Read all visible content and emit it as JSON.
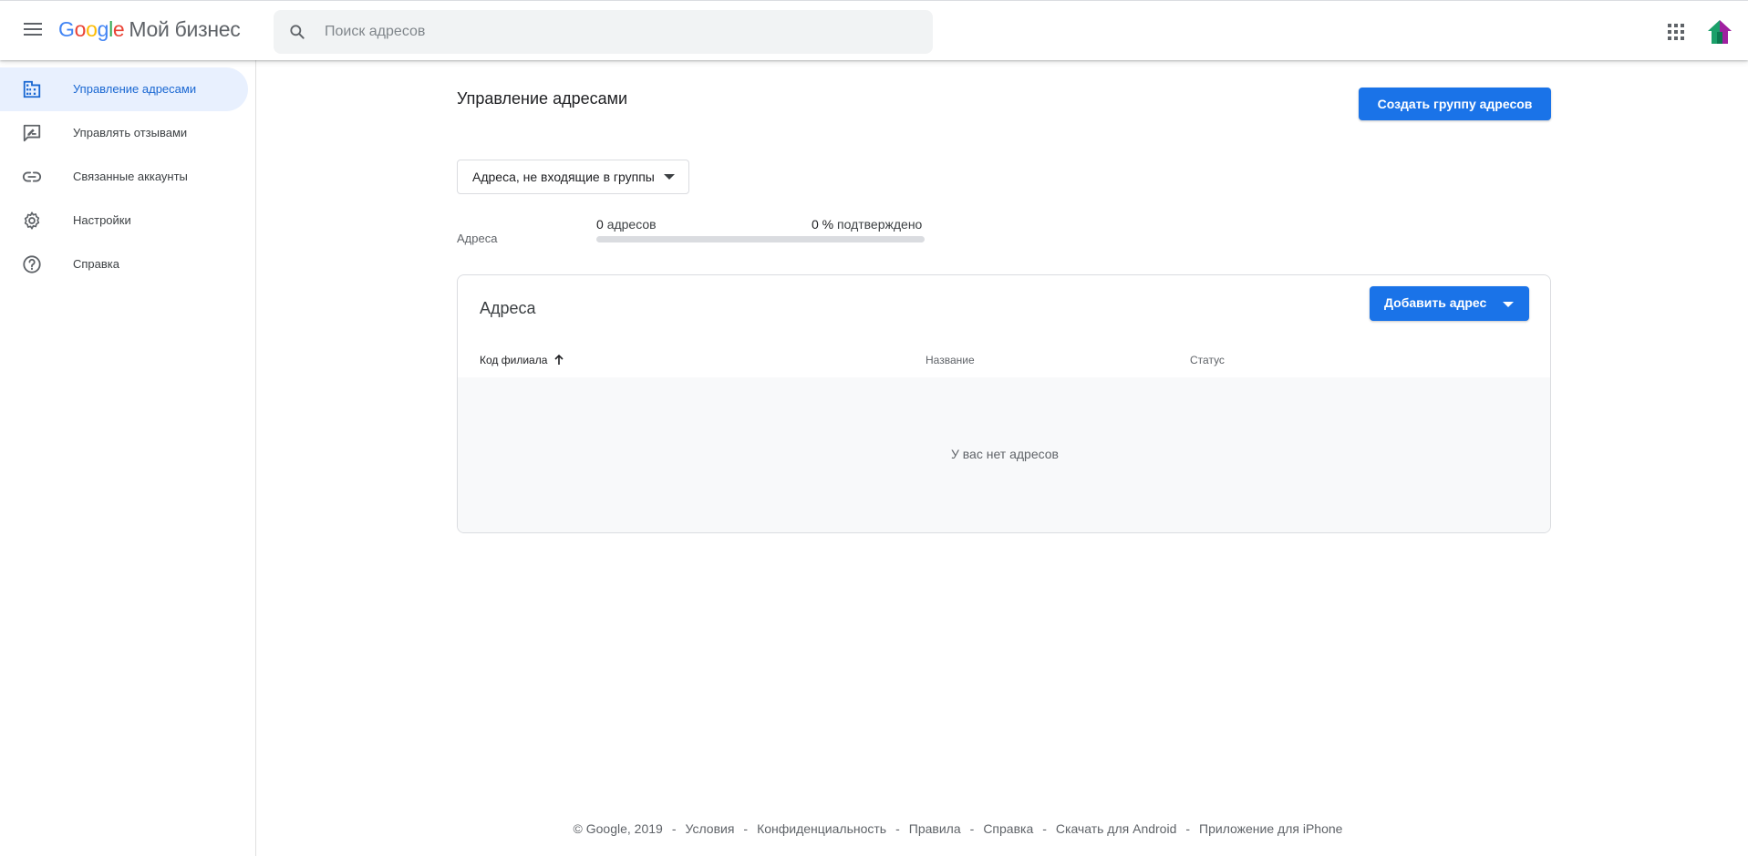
{
  "header": {
    "menu_icon": "hamburger-menu-icon",
    "logo_letters": [
      "G",
      "o",
      "o",
      "g",
      "l",
      "e"
    ],
    "product_name": "Мой бизнес",
    "search_placeholder": "Поиск адресов",
    "search_value": "",
    "apps_icon": "apps-grid-icon",
    "avatar_icon": "account-avatar-icon"
  },
  "sidebar": {
    "items": [
      {
        "label": "Управление адресами",
        "icon": "building-icon",
        "active": true
      },
      {
        "label": "Управлять отзывами",
        "icon": "review-icon",
        "active": false
      },
      {
        "label": "Связанные аккаунты",
        "icon": "link-icon",
        "active": false
      },
      {
        "label": "Настройки",
        "icon": "gear-icon",
        "active": false
      },
      {
        "label": "Справка",
        "icon": "help-icon",
        "active": false
      }
    ]
  },
  "main": {
    "title": "Управление адресами",
    "create_group_label": "Создать группу адресов",
    "filter_label": "Адреса, не входящие в группы",
    "stats": {
      "label": "Адреса",
      "count": "0",
      "count_unit": "адресов",
      "verified": "0 %",
      "verified_unit": "подтверждено",
      "verified_fraction": 0
    },
    "card": {
      "title": "Адреса",
      "add_label": "Добавить адрес",
      "columns": [
        "Код филиала",
        "Название",
        "Статус"
      ],
      "sort_icon": "arrow-up-icon",
      "empty_text": "У вас нет адресов",
      "rows": []
    }
  },
  "footer": {
    "copyright": "© Google, 2019",
    "links": [
      "Условия",
      "Конфиденциальность",
      "Правила",
      "Справка",
      "Скачать для Android",
      "Приложение для iPhone"
    ],
    "separator": "-"
  },
  "colors": {
    "accent": "#1a73e8",
    "active_nav_bg": "#e8f0fe",
    "active_nav_text": "#1967d2"
  }
}
